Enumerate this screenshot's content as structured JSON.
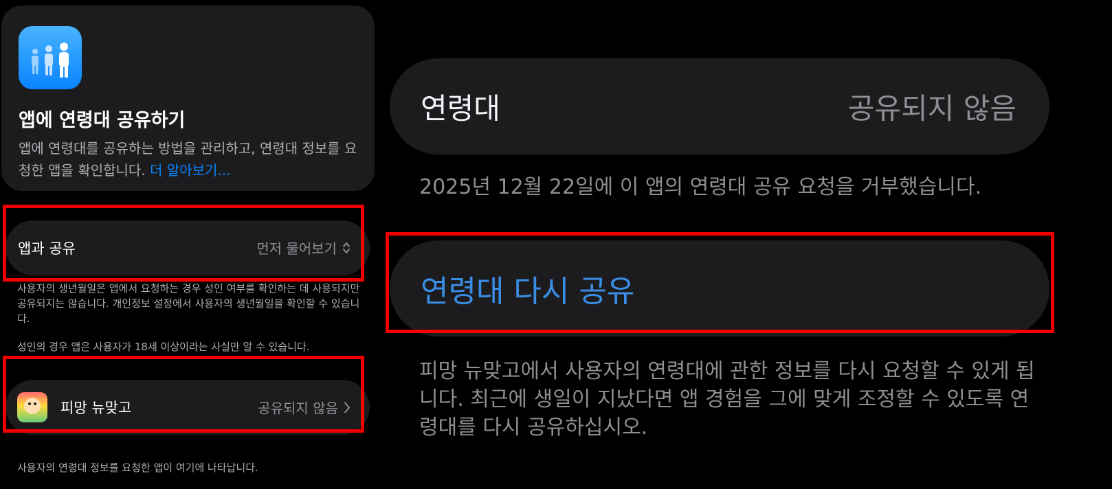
{
  "left_panel": {
    "header": {
      "icon": "people-group-icon",
      "title": "앱에 연령대 공유하기",
      "description": "앱에 연령대를 공유하는 방법을 관리하고, 연령대 정보를 요청한 앱을 확인합니다.",
      "learn_more": "더 알아보기..."
    },
    "share_with_apps": {
      "label": "앱과 공유",
      "value": "먼저 물어보기",
      "icon": "chevron-up-down-icon"
    },
    "share_footnote_1": "사용자의 생년월일은 앱에서 요청하는 경우 성인 여부를 확인하는 데 사용되지만 공유되지는 않습니다. 개인정보 설정에서 사용자의 생년월일을 확인할 수 있습니다.",
    "share_footnote_2": "성인의 경우 앱은 사용자가 18세 이상이라는 사실만 알 수 있습니다.",
    "app_row": {
      "name": "피망 뉴맞고",
      "status": "공유되지 않음",
      "icon": "chevron-right-icon"
    },
    "apps_footnote": "사용자의 연령대 정보를 요청한 앱이 여기에 나타납니다."
  },
  "right_panel": {
    "age_range": {
      "label": "연령대",
      "value": "공유되지 않음"
    },
    "decline_note": "2025년 12월 22일에 이 앱의 연령대 공유 요청을 거부했습니다.",
    "reshare_button": "연령대 다시 공유",
    "reshare_description": "피망 뉴맞고에서 사용자의 연령대에 관한 정보를 다시 요청할 수 있게 됩니다. 최근에 생일이 지났다면 앱 경험을 그에 맞게 조정할 수 있도록 연령대를 다시 공유하십시오."
  },
  "colors": {
    "background": "#000000",
    "card": "#1c1c1e",
    "accent_blue": "#0a84ff",
    "highlight_red": "#f20000",
    "secondary_text": "#8e8e93"
  }
}
